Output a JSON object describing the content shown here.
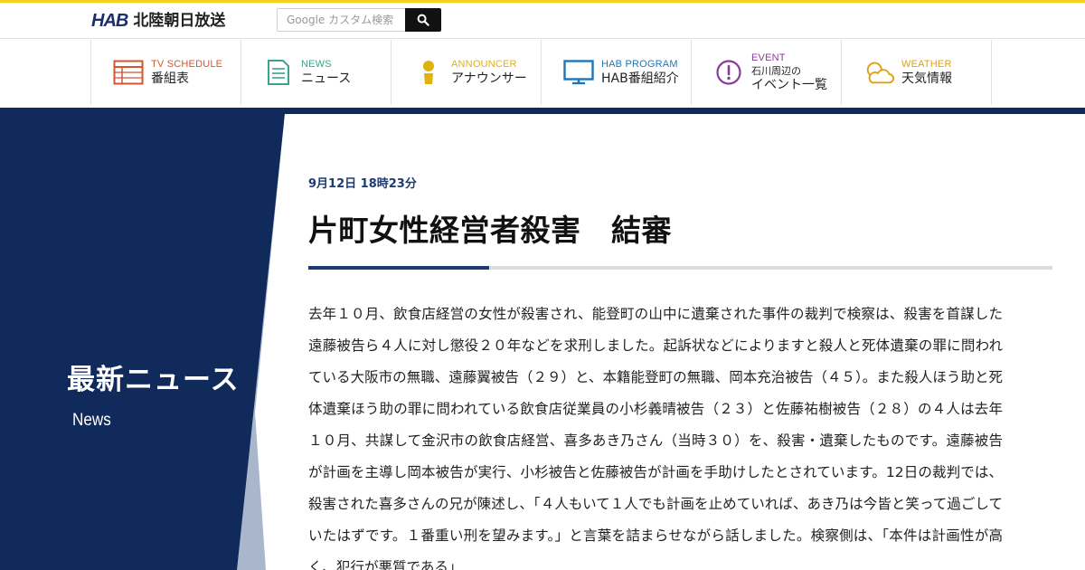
{
  "site": {
    "logo_mark": "HAB",
    "logo_name": "北陸朝日放送"
  },
  "search": {
    "placeholder": "Google カスタム検索"
  },
  "nav": [
    {
      "en": "TV SCHEDULE",
      "ja": "番組表",
      "color": "#d2562f",
      "icon": "tv-schedule-icon"
    },
    {
      "en": "NEWS",
      "ja": "ニュース",
      "color": "#3aa58c",
      "icon": "news-icon"
    },
    {
      "en": "ANNOUNCER",
      "ja": "アナウンサー",
      "color": "#e0b20e",
      "icon": "announcer-icon"
    },
    {
      "en": "HAB PROGRAM",
      "ja": "HAB番組紹介",
      "color": "#1f76b8",
      "icon": "tv-monitor-icon"
    },
    {
      "en": "EVENT",
      "ja_line1": "石川周辺の",
      "ja_line2": "イベント一覧",
      "color": "#8a3a9e",
      "icon": "exclamation-icon"
    },
    {
      "en": "WEATHER",
      "ja": "天気情報",
      "color": "#e0a010",
      "icon": "weather-icon"
    }
  ],
  "sidebar": {
    "title": "最新ニュース",
    "subtitle": "News"
  },
  "article": {
    "date": "9月12日 18時23分",
    "title": "片町女性経営者殺害　結審",
    "body": "去年１０月、飲食店経営の女性が殺害され、能登町の山中に遺棄された事件の裁判で検察は、殺害を首謀した遠藤被告ら４人に対し懲役２０年などを求刑しました。起訴状などによりますと殺人と死体遺棄の罪に問われている大阪市の無職、遠藤翼被告（２９）と、本籍能登町の無職、岡本充治被告（４５）。また殺人ほう助と死体遺棄ほう助の罪に問われている飲食店従業員の小杉義晴被告（２３）と佐藤祐樹被告（２８）の４人は去年１０月、共謀して金沢市の飲食店経営、喜多あき乃さん（当時３０）を、殺害・遺棄したものです。遠藤被告が計画を主導し岡本被告が実行、小杉被告と佐藤被告が計画を手助けしたとされています。12日の裁判では、殺害された喜多さんの兄が陳述し、「４人もいて１人でも計画を止めていれば、あき乃は今皆と笑って過ごしていたはずです。１番重い刑を望みます。」と言葉を詰まらせながら話しました。検察側は、「本件は計画性が高く、犯行が悪質である」"
  },
  "colors": {
    "top_line": "#f3d21e",
    "navy": "#102a5c",
    "accent_blue": "#1d3a72"
  }
}
